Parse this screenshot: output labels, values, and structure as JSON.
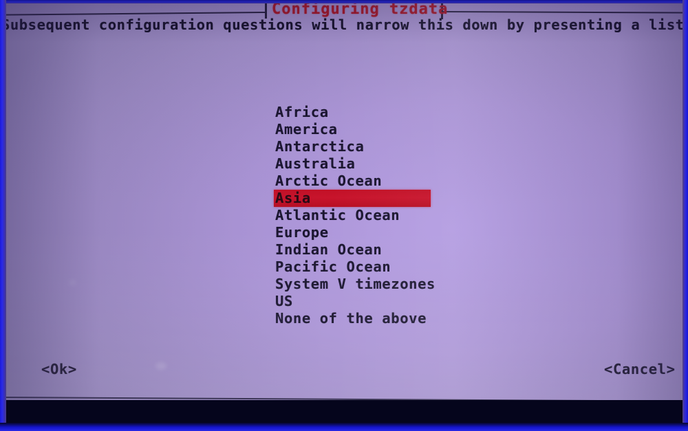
{
  "dialog": {
    "title": "Configuring tzdata",
    "prompt": "Subsequent configuration questions will narrow this down by presenting a list of",
    "selected_index": 5,
    "items": [
      "Africa",
      "America",
      "Antarctica",
      "Australia",
      "Arctic Ocean",
      "Asia",
      "Atlantic Ocean",
      "Europe",
      "Indian Ocean",
      "Pacific Ocean",
      "System V timezones",
      "US",
      "None of the above"
    ],
    "buttons": {
      "ok": "<Ok>",
      "cancel": "<Cancel>"
    }
  },
  "colors": {
    "screen_background": "#ab95d6",
    "text": "#1b1630",
    "title": "#a01523",
    "selection_background": "#c4122a",
    "border": "#241f3c",
    "bezel_glow": "#2a2ae6"
  }
}
